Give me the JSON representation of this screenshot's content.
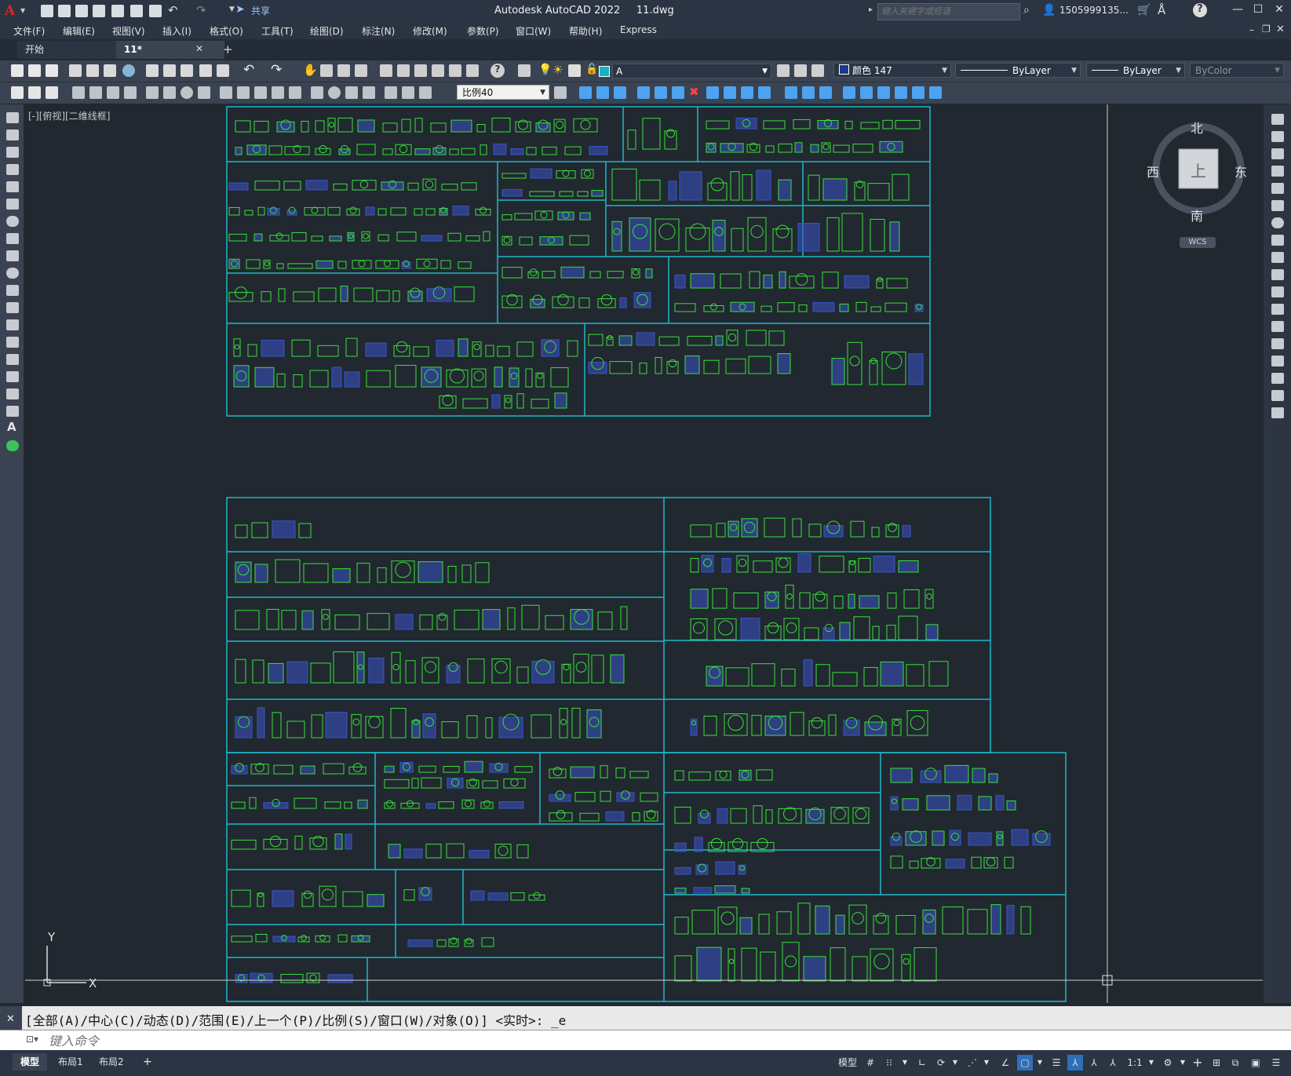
{
  "titlebar": {
    "app_title": "Autodesk AutoCAD 2022     11.dwg",
    "share_label": "共享",
    "search_placeholder": "键入关键字或短语",
    "user_name": "1505999135...",
    "minimize": "—",
    "maximize": "☐",
    "close": "✕"
  },
  "menu": [
    "文件(F)",
    "编辑(E)",
    "视图(V)",
    "插入(I)",
    "格式(O)",
    "工具(T)",
    "绘图(D)",
    "标注(N)",
    "修改(M)",
    "参数(P)",
    "窗口(W)",
    "帮助(H)",
    "Express"
  ],
  "tabs": {
    "start": "开始",
    "active": "11*",
    "close": "✕",
    "new": "+"
  },
  "toolbar": {
    "layer": "A",
    "color": "颜色 147",
    "linetype": "ByLayer",
    "lineweight": "ByLayer",
    "plotstyle": "ByColor",
    "scale": "比例40"
  },
  "viewport_label": "[-][俯视][二维线框]",
  "viewcube": {
    "north": "北",
    "south": "南",
    "east": "东",
    "west": "西",
    "top": "上",
    "wcs": "WCS"
  },
  "ucs": {
    "x": "X",
    "y": "Y"
  },
  "command": {
    "history": "[全部(A)/中心(C)/动态(D)/范围(E)/上一个(P)/比例(S)/窗口(W)/对象(O)] <实时>: _e",
    "placeholder": "键入命令"
  },
  "status": {
    "layouts": [
      "模型",
      "布局1",
      "布局2"
    ],
    "add_layout": "+",
    "model_label": "模型",
    "scale": "1:1"
  },
  "colors": {
    "cad_background": "#212830",
    "frame_cyan": "#1fb8c8",
    "block_green": "#3adf3a",
    "block_blue": "#3a54c8"
  }
}
